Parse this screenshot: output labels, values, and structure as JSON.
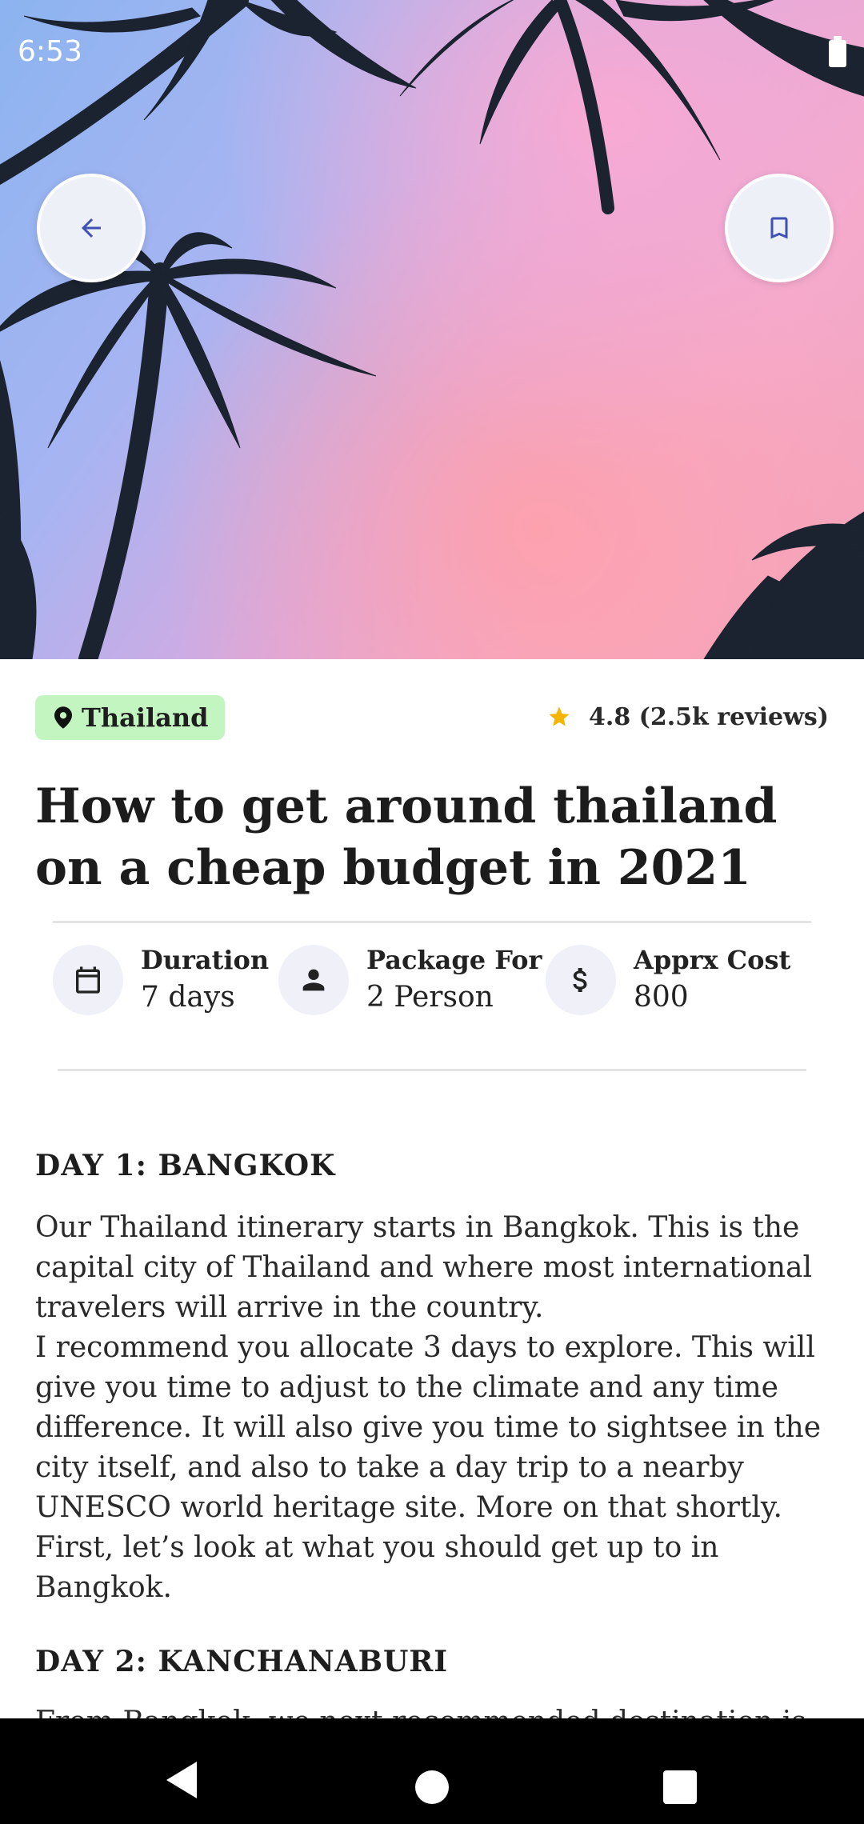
{
  "status_bar": {
    "time": "6:53"
  },
  "header": {
    "back_icon": "arrow-left-icon",
    "bookmark_icon": "bookmark-icon",
    "icon_color": "#3f51b5"
  },
  "tag": {
    "location": "Thailand",
    "icon": "map-pin-icon",
    "bg_color": "#c3f5c0"
  },
  "rating": {
    "text": "4.8 (2.5k reviews)",
    "icon": "star-icon",
    "star_color": "#f5b400"
  },
  "article": {
    "title": "How to get around thailand on a cheap budget in 2021"
  },
  "info": [
    {
      "label": "Duration",
      "value": "7 days",
      "icon": "calendar-icon"
    },
    {
      "label": "Package For",
      "value": "2 Person",
      "icon": "person-icon"
    },
    {
      "label": "Apprx Cost",
      "value": "800",
      "icon": "dollar-icon"
    }
  ],
  "sections": [
    {
      "heading": "DAY 1: BANGKOK",
      "paragraphs": [
        "Our Thailand itinerary starts in Bangkok. This is the capital city of Thailand and where most international travelers will arrive in the country.",
        "I recommend you allocate 3 days to explore. This will give you time to adjust to the climate and any time difference. It will also give you time to sightsee in the city itself, and also to take a day trip to a nearby UNESCO world heritage site. More on that shortly. First, let’s look at what you should get up to in Bangkok."
      ]
    },
    {
      "heading": "DAY 2: KANCHANABURI",
      "paragraphs": [
        "From Bangkok, we next recommended destination is"
      ]
    }
  ],
  "nav_bar": {
    "back_icon": "nav-back-icon",
    "home_icon": "nav-home-icon",
    "recents_icon": "nav-recents-icon"
  }
}
